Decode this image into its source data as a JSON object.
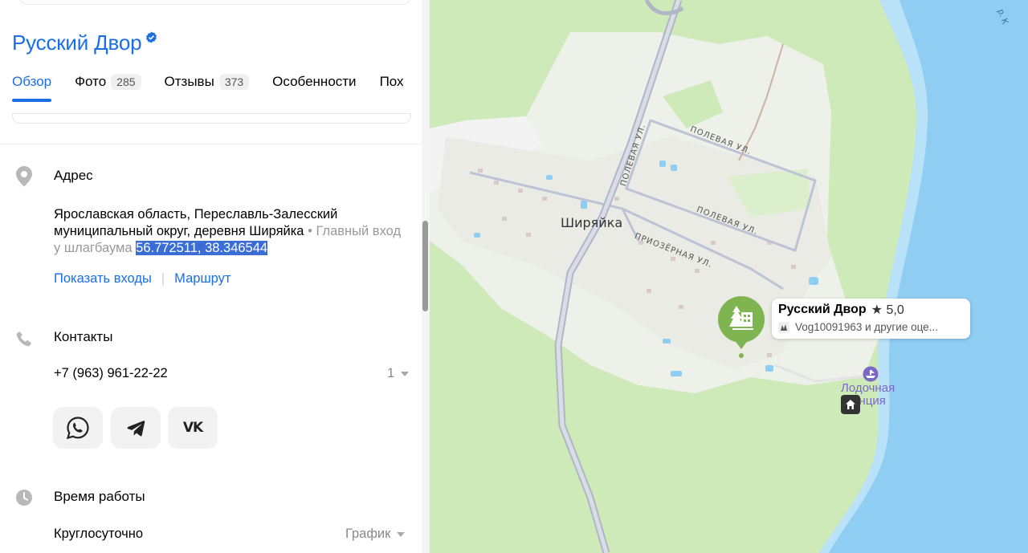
{
  "place": {
    "title": "Русский Двор",
    "verified_icon": "verified-check-icon"
  },
  "tabs": [
    {
      "label": "Обзор",
      "count": "",
      "active": true
    },
    {
      "label": "Фото",
      "count": "285"
    },
    {
      "label": "Отзывы",
      "count": "373"
    },
    {
      "label": "Особенности",
      "count": ""
    },
    {
      "label": "Пох",
      "count": ""
    }
  ],
  "address": {
    "heading": "Адрес",
    "line": "Ярославская область, Переславль-Залесский муниципальный округ, деревня Ширяйка",
    "separator": " • ",
    "note": "Главный вход у шлагбаума",
    "coordinates": "56.772511, 38.346544",
    "show_entrances": "Показать входы",
    "route": "Маршрут",
    "icon": "location-pin-icon"
  },
  "contacts": {
    "heading": "Контакты",
    "phone": "+7 (963) 961-22-22",
    "phone_count": "1",
    "icon": "phone-icon",
    "social": [
      "whatsapp-icon",
      "telegram-icon",
      "vk-icon"
    ],
    "vk_text": "VK"
  },
  "hours": {
    "heading": "Время работы",
    "value": "Круглосуточно",
    "schedule": "График",
    "icon": "clock-icon"
  },
  "map": {
    "village": "Ширяйка",
    "streets": [
      "ПОЛЕВАЯ УЛ.",
      "ПОЛЕВАЯ УЛ.",
      "ПОЛЕВАЯ УЛ.",
      "ПРИОЗЁРНАЯ УЛ."
    ],
    "poi_name": "Русский Двор",
    "poi_rating": "5,0",
    "poi_review": "Vog10091963 и другие оце...",
    "boat_station_line1": "Лодочная",
    "boat_station_line2": "станция",
    "corner_text": "р. К"
  },
  "colors": {
    "accent": "#1a6ee6",
    "forest": "#cdeab8",
    "water": "#8fcdf3",
    "poi_green": "#7fb550"
  }
}
